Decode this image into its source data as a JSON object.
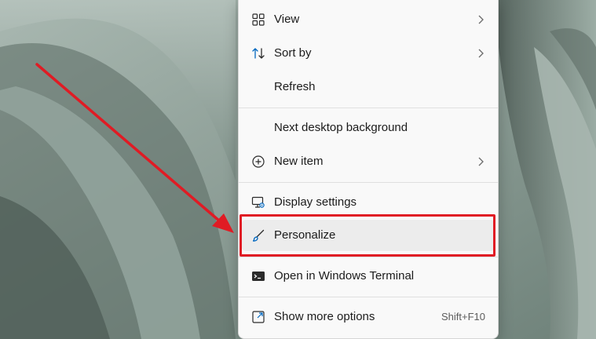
{
  "context_menu": {
    "items": [
      {
        "id": "view",
        "label": "View",
        "icon": "grid-icon",
        "has_submenu": true
      },
      {
        "id": "sort-by",
        "label": "Sort by",
        "icon": "sort-icon",
        "has_submenu": true
      },
      {
        "id": "refresh",
        "label": "Refresh",
        "icon": "",
        "has_submenu": false
      },
      {
        "id": "next-desktop-background",
        "label": "Next desktop background",
        "icon": "",
        "has_submenu": false
      },
      {
        "id": "new-item",
        "label": "New item",
        "icon": "plus-circle-icon",
        "has_submenu": true
      },
      {
        "id": "display-settings",
        "label": "Display settings",
        "icon": "monitor-settings-icon",
        "has_submenu": false
      },
      {
        "id": "personalize",
        "label": "Personalize",
        "icon": "brush-icon",
        "has_submenu": false,
        "highlighted": true
      },
      {
        "id": "open-in-windows-terminal",
        "label": "Open in Windows Terminal",
        "icon": "terminal-icon",
        "has_submenu": false
      },
      {
        "id": "show-more-options",
        "label": "Show more options",
        "icon": "expand-icon",
        "has_submenu": false,
        "shortcut": "Shift+F10"
      }
    ]
  },
  "colors": {
    "annotation_red": "#e01b24",
    "menu_background": "#f9f9f9",
    "accent_blue": "#0067c0"
  }
}
